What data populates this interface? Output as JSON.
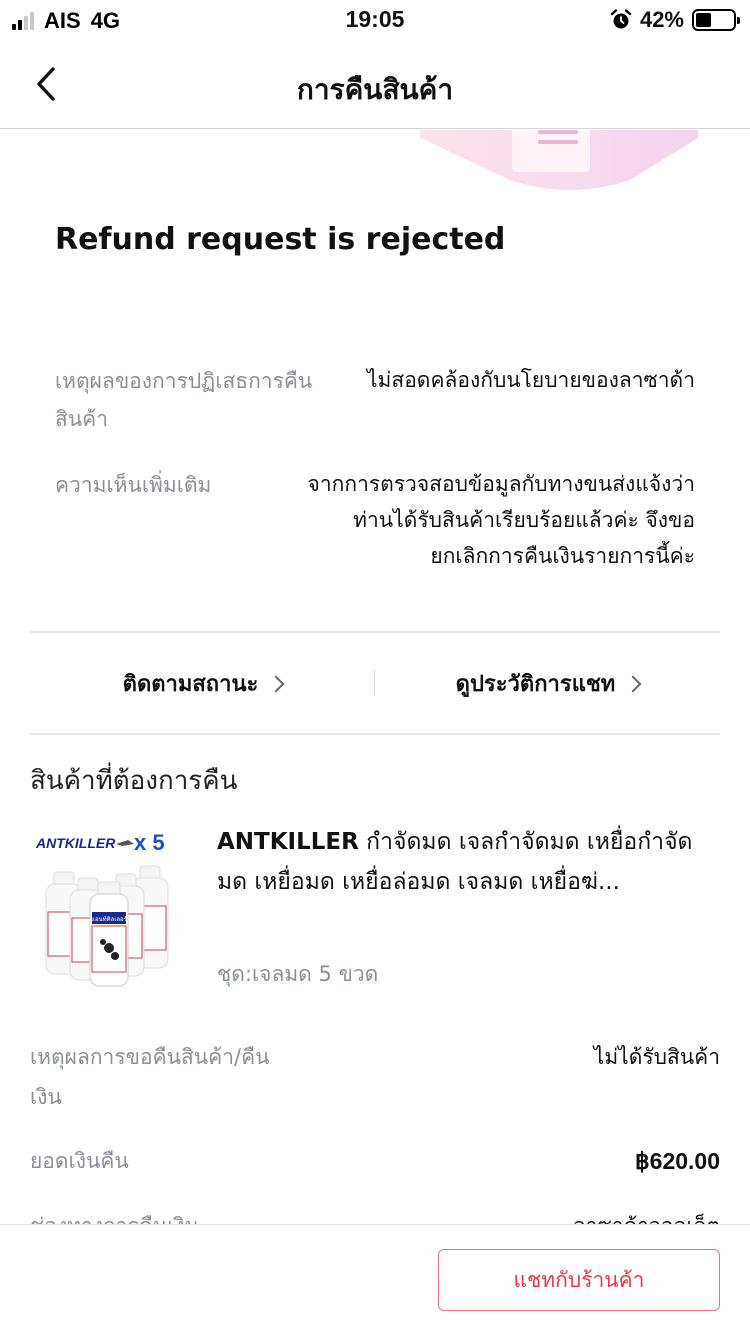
{
  "status_bar": {
    "carrier": "AIS",
    "network": "4G",
    "time": "19:05",
    "battery_percent_text": "42%",
    "battery_level": 0.42,
    "icons": [
      "signal-icon",
      "alarm-icon",
      "battery-icon"
    ]
  },
  "header": {
    "title": "การคืนสินค้า",
    "back_icon": "chevron-left-icon"
  },
  "refund": {
    "status_title": "Refund request is rejected",
    "reject_reason_label": "เหตุผลของการปฏิเสธการคืนสินค้า",
    "reject_reason_value": "ไม่สอดคล้องกับนโยบายของลาซาด้า",
    "comment_label": "ความเห็นเพิ่มเติม",
    "comment_value": "จากการตรวจสอบข้อมูลกับทางขนส่งแจ้งว่าท่านได้รับสินค้าเรียบร้อยแล้วค่ะ จึงขอยกเลิกการคืนเงินรายการนี้ค่ะ"
  },
  "links": {
    "track_status": "ติดตามสถานะ",
    "chat_history": "ดูประวัติการแชท"
  },
  "returned_items": {
    "section_title": "สินค้าที่ต้องการคืน",
    "product": {
      "brand": "ANTKILLER",
      "name_rest": " กำจัดมด เจลกำจัดมด เหยื่อกำจัดมด เหยื่อมด เหยื่อล่อมด เจลมด เหยื่อฆ่...",
      "variant": "ชุด:เจลมด 5 ขวด",
      "image_text_brand": "ANTKILLER",
      "image_text_qty": "x 5",
      "bottle_label": "แอนท์คิลเลอร์"
    }
  },
  "details": {
    "reason_label": "เหตุผลการขอคืนสินค้า/คืนเงิน",
    "reason_value": "ไม่ได้รับสินค้า",
    "refund_amount_label": "ยอดเงินคืน",
    "refund_amount_value": "฿620.00",
    "refund_channel_label": "ช่องทางการคืนเงิน",
    "refund_channel_value": "ลาซาด้าวอลเล็ต"
  },
  "bottom": {
    "chat_button": "แชทกับร้านค้า"
  },
  "colors": {
    "accent": "#e8384a",
    "muted_text": "#8a8f9a",
    "divider": "#e6e8ef",
    "illustration_pink": "#f6cfe6"
  }
}
